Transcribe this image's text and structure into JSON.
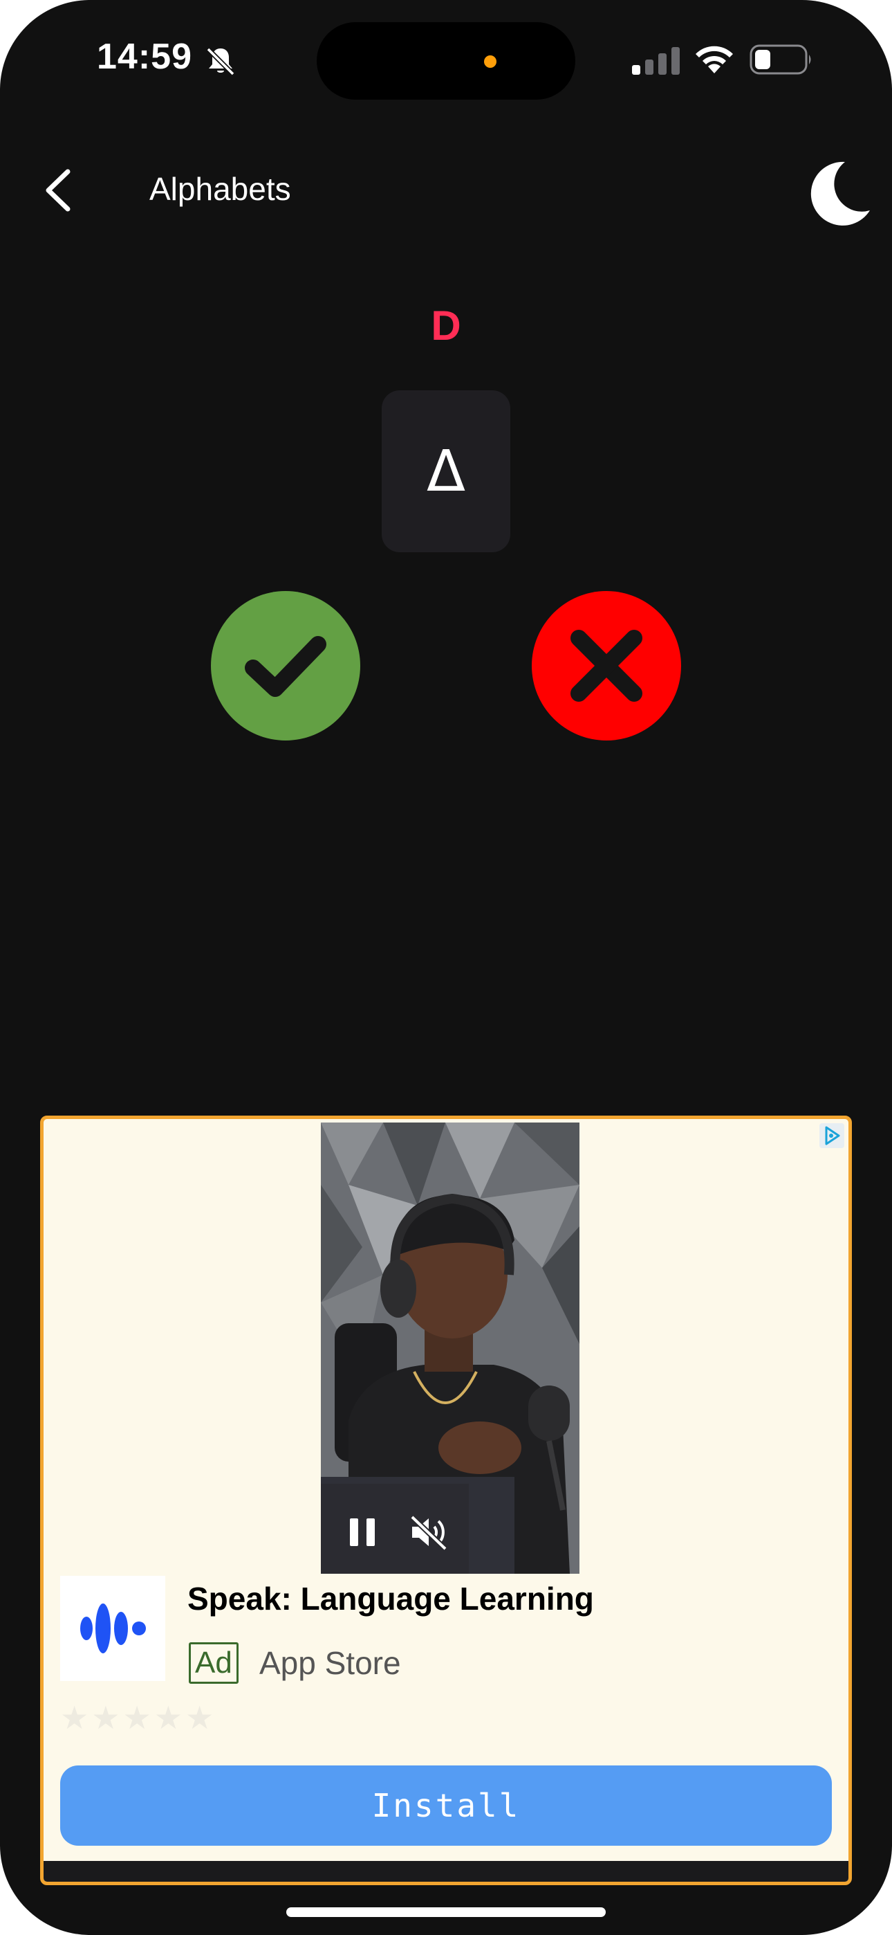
{
  "status_bar": {
    "time": "14:59",
    "icons": [
      "bell-slash-icon",
      "signal-icon",
      "wifi-icon",
      "battery-icon"
    ]
  },
  "header": {
    "title": "Alphabets",
    "back_icon": "chevron-left-icon",
    "theme_icon": "moon-icon"
  },
  "quiz": {
    "letter": "D",
    "symbol": "Δ",
    "correct_icon": "checkmark-icon",
    "wrong_icon": "x-icon"
  },
  "ad": {
    "app_name": "Speak: Language Learning",
    "ad_label": "Ad",
    "store": "App Store",
    "rating_stars": "★★★★★",
    "install_label": "Install",
    "video_controls": [
      "pause-icon",
      "muted-speaker-icon"
    ],
    "adchoices_icon": "adchoices-icon"
  },
  "colors": {
    "background": "#111111",
    "letter": "#ff2d55",
    "correct": "#63a044",
    "wrong": "#ff0000",
    "ad_border": "#f2a530",
    "ad_background": "#fdf9ea",
    "install_button": "#559cf3",
    "ad_badge": "#3a6b2c"
  }
}
